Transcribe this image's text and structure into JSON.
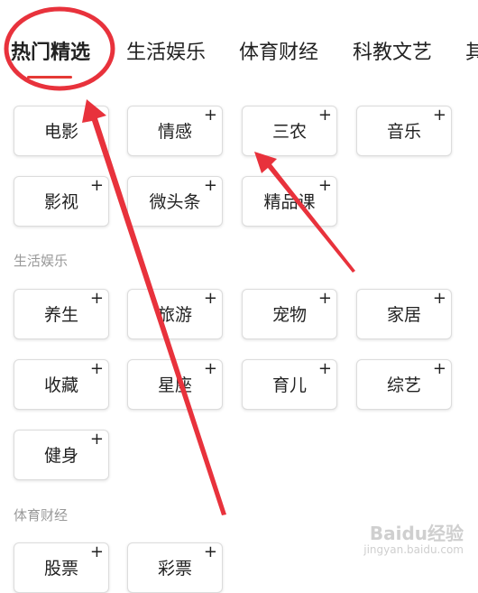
{
  "tabs": [
    {
      "label": "热门精选",
      "active": true
    },
    {
      "label": "生活娱乐",
      "active": false
    },
    {
      "label": "体育财经",
      "active": false
    },
    {
      "label": "科教文艺",
      "active": false
    },
    {
      "label": "其",
      "active": false
    }
  ],
  "sections": [
    {
      "title": "",
      "chips": [
        "电影",
        "情感",
        "三农",
        "音乐",
        "影视",
        "微头条",
        "精品课"
      ]
    },
    {
      "title": "生活娱乐",
      "chips": [
        "养生",
        "旅游",
        "宠物",
        "家居",
        "收藏",
        "星座",
        "育儿",
        "综艺",
        "健身"
      ]
    },
    {
      "title": "体育财经",
      "chips": [
        "股票",
        "彩票"
      ]
    }
  ],
  "chip_add_symbol": "+",
  "annotation_color": "#e8323c",
  "tab_underline_color": "#e53935",
  "watermark": {
    "main": "Baidu经验",
    "sub": "jingyan.baidu.com"
  }
}
